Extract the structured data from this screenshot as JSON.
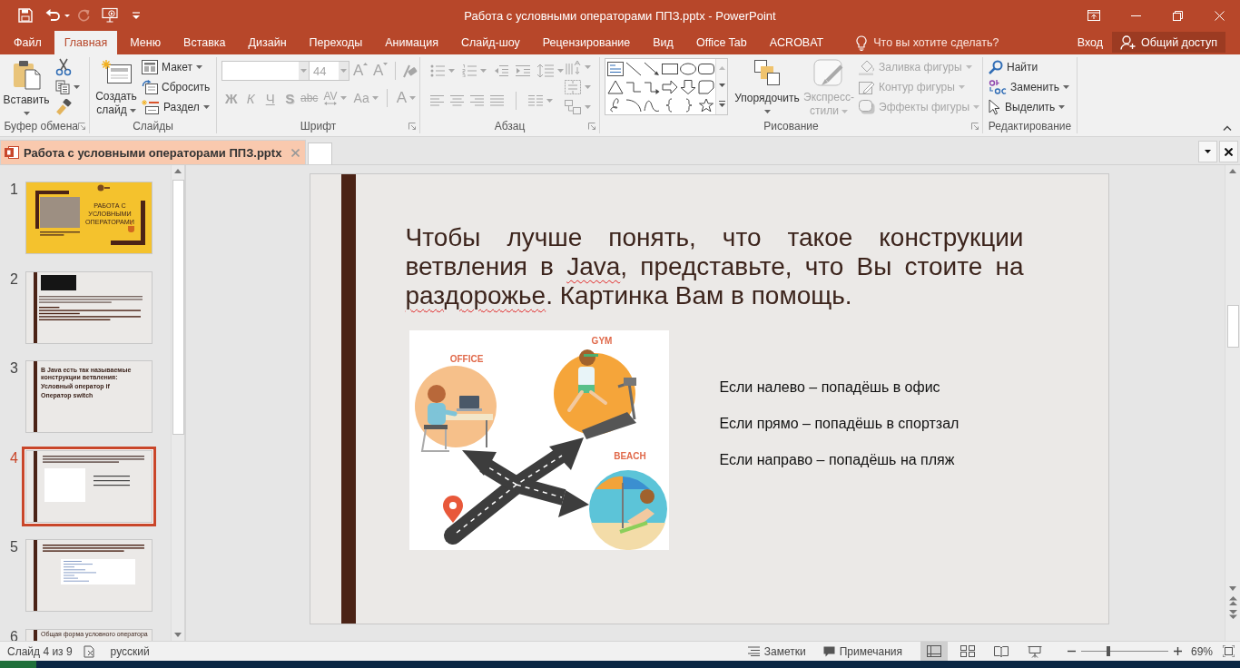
{
  "window": {
    "title": "Работа с условными операторами ППЗ.pptx - PowerPoint"
  },
  "quick_access": {
    "redo": {
      "disabled": true
    }
  },
  "menu_tabs": [
    {
      "label": "Файл",
      "selected": false
    },
    {
      "label": "Главная",
      "selected": true
    },
    {
      "label": "Меню",
      "selected": false
    },
    {
      "label": "Вставка",
      "selected": false
    },
    {
      "label": "Дизайн",
      "selected": false
    },
    {
      "label": "Переходы",
      "selected": false
    },
    {
      "label": "Анимация",
      "selected": false
    },
    {
      "label": "Слайд-шоу",
      "selected": false
    },
    {
      "label": "Рецензирование",
      "selected": false
    },
    {
      "label": "Вид",
      "selected": false
    },
    {
      "label": "Office Tab",
      "selected": false
    },
    {
      "label": "ACROBAT",
      "selected": false
    }
  ],
  "tell_me": {
    "placeholder": "Что вы хотите сделать?"
  },
  "account": {
    "sign_in": "Вход",
    "share": "Общий доступ"
  },
  "ribbon": {
    "clipboard": {
      "label": "Буфер обмена",
      "paste": "Вставить"
    },
    "slides": {
      "label": "Слайды",
      "new_slide": "Создать слайд",
      "commands": [
        {
          "label": "Макет",
          "dropdown": true
        },
        {
          "label": "Сбросить",
          "dropdown": false
        },
        {
          "label": "Раздел",
          "dropdown": true
        }
      ]
    },
    "font": {
      "label": "Шрифт",
      "disabled": true,
      "size": "44",
      "size_buttons": [
        "A",
        "A"
      ],
      "format_buttons": [
        "Ж",
        "К",
        "Ч",
        "S",
        "abc",
        "AV",
        "Aa",
        "A"
      ]
    },
    "paragraph": {
      "label": "Абзац",
      "disabled": true
    },
    "drawing": {
      "label": "Рисование",
      "arrange": "Упорядочить",
      "quick_styles": {
        "label": "Экспресс-стили",
        "disabled": true
      },
      "shape_commands": [
        {
          "label": "Заливка фигуры",
          "disabled": true
        },
        {
          "label": "Контур фигуры",
          "disabled": true
        },
        {
          "label": "Эффекты фигуры",
          "disabled": true
        }
      ]
    },
    "editing": {
      "label": "Редактирование",
      "commands": [
        {
          "label": "Найти",
          "dropdown": false
        },
        {
          "label": "Заменить",
          "dropdown": true
        },
        {
          "label": "Выделить",
          "dropdown": true
        }
      ]
    }
  },
  "document_tabs": [
    {
      "label": "Работа с условными операторами ППЗ.pptx",
      "selected": true
    }
  ],
  "thumbnails": [
    {
      "number": "1",
      "selected": false,
      "kind": "title",
      "title": "РАБОТА С УСЛОВНЫМИ ОПЕРАТОРАМИ"
    },
    {
      "number": "2",
      "selected": false,
      "kind": "image_text"
    },
    {
      "number": "3",
      "selected": false,
      "kind": "bullets",
      "lines": [
        "В Java есть так называемые конструкции ветвления:",
        "Условный оператор if",
        "Оператор switch"
      ]
    },
    {
      "number": "4",
      "selected": true,
      "kind": "picture_text"
    },
    {
      "number": "5",
      "selected": false,
      "kind": "code"
    },
    {
      "number": "6",
      "selected": false,
      "kind": "heading",
      "lines": [
        "Общая форма условного оператора"
      ]
    }
  ],
  "slide": {
    "title_parts": [
      {
        "text": "Чтобы лучше понять, что такое конструкции ветвления в ",
        "misspelled": false
      },
      {
        "text": "Java",
        "misspelled": true
      },
      {
        "text": ", представьте, что Вы стоите на ",
        "misspelled": false
      },
      {
        "text": "раздорожье",
        "misspelled": true
      },
      {
        "text": ". Картинка Вам в помощь.",
        "misspelled": false
      }
    ],
    "picture": {
      "labels": [
        "OFFICE",
        "GYM",
        "BEACH"
      ]
    },
    "lines": [
      "Если налево – попадёшь в офис",
      "Если прямо – попадёшь в спортзал",
      "Если направо – попадёшь на пляж"
    ]
  },
  "status_bar": {
    "slide_info": "Слайд 4 из 9",
    "language": "русский",
    "notes": "Заметки",
    "comments": "Примечания",
    "views": [
      {
        "selected": true
      },
      {
        "selected": false
      },
      {
        "selected": false
      },
      {
        "selected": false
      }
    ],
    "zoom": {
      "level": 0.3,
      "reading": "69%"
    }
  }
}
